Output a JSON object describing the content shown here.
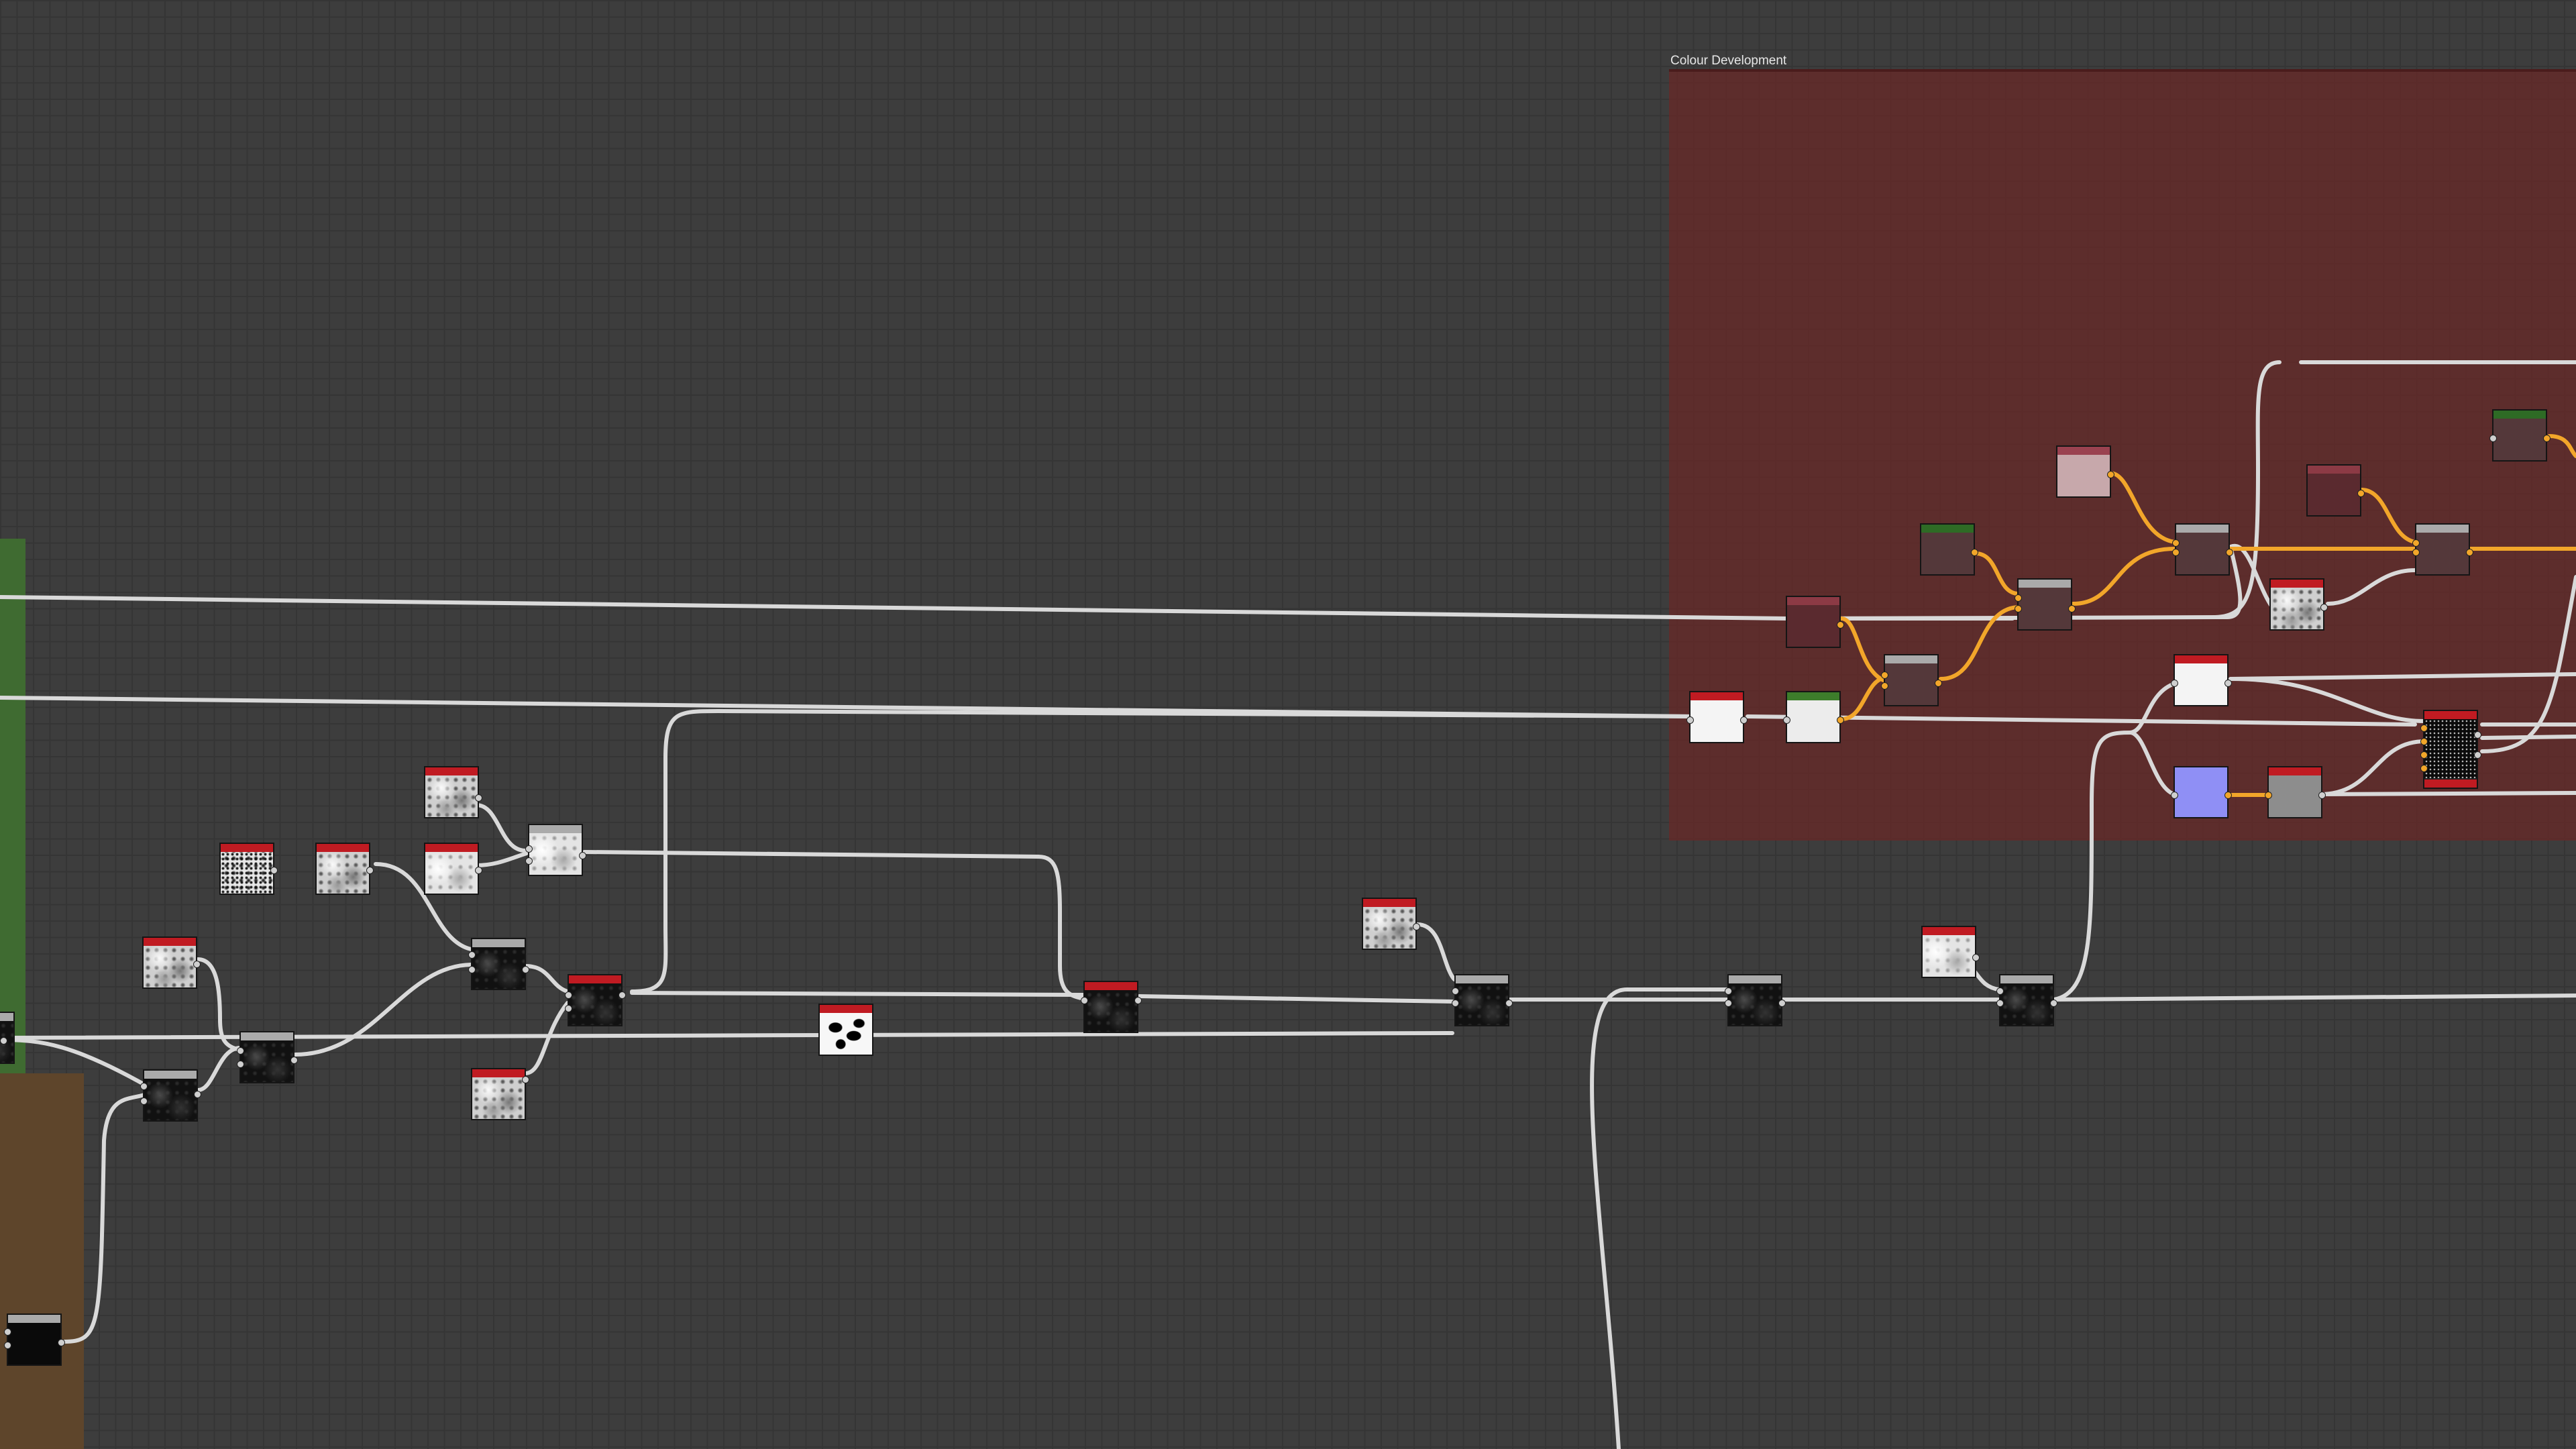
{
  "canvas": {
    "frames": [
      {
        "title": "Colour Development",
        "color": "#642a28"
      },
      {
        "title": "",
        "color": "#3f6b31"
      },
      {
        "title": "",
        "color": "#5e452b"
      }
    ]
  },
  "wire_colors": {
    "default": "#d9d9d9",
    "colour": "#f2a62a"
  },
  "node_colors": {
    "generator_header": "#c01b22",
    "filter_header": "#aaaaaa",
    "uniform_header_green": "#3d7d2b",
    "uniform_header_maroon": "#8c3a45",
    "color_fill_periwinkle": "#8f8ff5"
  },
  "nodes": [
    {
      "name": "node-noise-grainy-1",
      "icon": "noise-thumbnail"
    },
    {
      "name": "node-noise-grainy-2",
      "icon": "noise-thumbnail"
    },
    {
      "name": "node-noise-cloud-1",
      "icon": "noise-thumbnail"
    },
    {
      "name": "node-noise-cloud-2",
      "icon": "noise-thumbnail"
    },
    {
      "name": "node-noise-grainy-3",
      "icon": "noise-thumbnail"
    },
    {
      "name": "node-blend-1",
      "icon": "blend-thumbnail"
    },
    {
      "name": "node-noise-grainy-4",
      "icon": "noise-thumbnail"
    },
    {
      "name": "node-black-1",
      "icon": "black-thumbnail"
    },
    {
      "name": "node-blend-2",
      "icon": "blend-thumbnail"
    },
    {
      "name": "node-blend-3",
      "icon": "blend-thumbnail"
    },
    {
      "name": "node-noise-grainy-5",
      "icon": "noise-thumbnail"
    },
    {
      "name": "node-dark-red-1",
      "icon": "dark-thumbnail"
    },
    {
      "name": "node-blobs-1",
      "icon": "blobs-thumbnail"
    },
    {
      "name": "node-dark-red-2",
      "icon": "dark-thumbnail"
    },
    {
      "name": "node-noise-cloud-3",
      "icon": "noise-thumbnail"
    },
    {
      "name": "node-blend-4",
      "icon": "blend-thumbnail"
    },
    {
      "name": "node-blend-5",
      "icon": "blend-thumbnail"
    },
    {
      "name": "node-noise-cloud-4",
      "icon": "noise-thumbnail"
    },
    {
      "name": "node-blend-6",
      "icon": "blend-thumbnail"
    },
    {
      "name": "node-black-2",
      "icon": "black-thumbnail"
    }
  ]
}
